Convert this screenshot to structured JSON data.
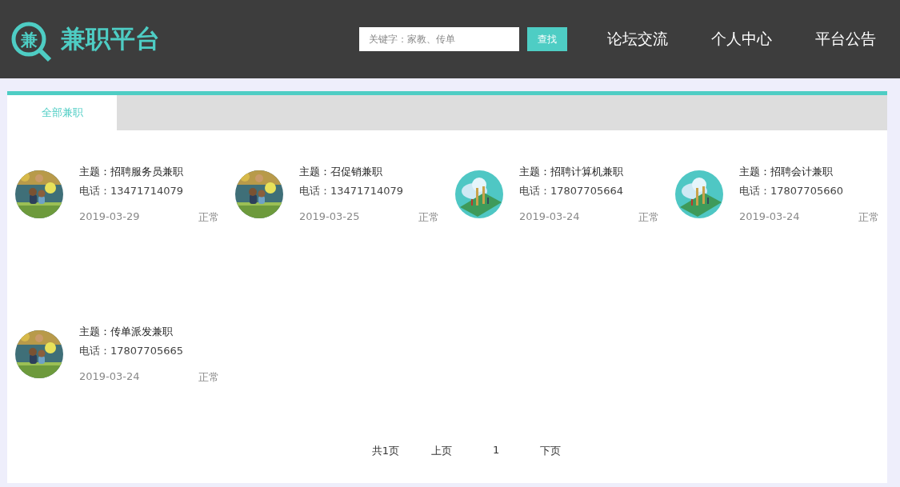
{
  "header": {
    "logo_glyph": "兼",
    "title": "兼职平台",
    "search": {
      "placeholder": "关键字：家教、传单"
    },
    "search_button": "查找",
    "nav": [
      "论坛交流",
      "个人中心",
      "平台公告"
    ]
  },
  "tabs": [
    {
      "label": "全部兼职",
      "selected": true
    }
  ],
  "jobs": [
    {
      "kind": "fireworks",
      "subject": "主题：招聘服务员兼职",
      "phone": "电话：13471714079",
      "date": "2019-03-29",
      "status": "正常"
    },
    {
      "kind": "fireworks",
      "subject": "主题：召促销兼职",
      "phone": "电话：13471714079",
      "date": "2019-03-25",
      "status": "正常"
    },
    {
      "kind": "cloud",
      "subject": "主题：招聘计算机兼职",
      "phone": "电话：17807705664",
      "date": "2019-03-24",
      "status": "正常"
    },
    {
      "kind": "cloud",
      "subject": "主题：招聘会计兼职",
      "phone": "电话：17807705660",
      "date": "2019-03-24",
      "status": "正常"
    },
    {
      "kind": "fireworks",
      "subject": "主题：传单派发兼职",
      "phone": "电话：17807705665",
      "date": "2019-03-24",
      "status": "正常"
    }
  ],
  "pagination": {
    "total": "共1页",
    "prev": "上页",
    "current": "1",
    "next": "下页"
  }
}
